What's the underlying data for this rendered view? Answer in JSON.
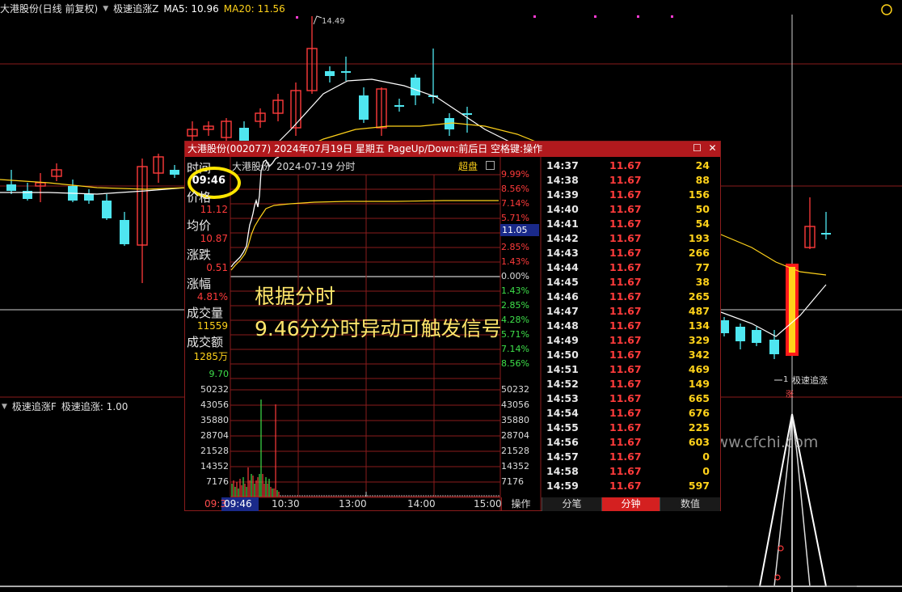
{
  "main_chart": {
    "stock_title": "大港股份(日线 前复权)",
    "indicator_name": "极速追涨Z",
    "ma5_label": "MA5: 10.96",
    "ma20_label": "MA20: 11.56",
    "peak_price_label": "14.49",
    "signal_label": "极速追涨",
    "signal_tag": "涨",
    "low_mark_label": "1"
  },
  "sub_chart": {
    "indicator_name": "极速追涨F",
    "value_label": "极速追涨: 1.00",
    "watermark": "www.cfchi.com"
  },
  "popup": {
    "title": "大港股份(002077) 2024年07月19日 星期五 PageUp/Down:前后日 空格键:操作",
    "header_name": "大港股份",
    "header_date": "2024-07-19 分时",
    "header_mode": "超盘",
    "left_panel": {
      "time_label": "时间",
      "time_value": "09:46",
      "price_label": "价格",
      "price_value": "11.12",
      "avg_label": "均价",
      "avg_value": "10.87",
      "change_label": "涨跌",
      "change_value": "0.51",
      "pct_label": "涨幅",
      "pct_value": "4.81%",
      "vol_label": "成交量",
      "vol_value": "11559",
      "amount_label": "成交额",
      "amount_value": "1285万"
    },
    "price_axis_left": [
      "9.70"
    ],
    "pct_axis": [
      "9.99%",
      "8.56%",
      "7.14%",
      "5.71%",
      "4.28%",
      "2.85%",
      "1.43%",
      "0.00%",
      "1.43%",
      "2.85%",
      "4.28%",
      "5.71%",
      "7.14%",
      "8.56%"
    ],
    "current_price_tag": "11.05",
    "volume_axis_left": [
      "50232",
      "43056",
      "35880",
      "28704",
      "21528",
      "14352",
      "7176"
    ],
    "volume_axis_right": [
      "50232",
      "43056",
      "35880",
      "28704",
      "21528",
      "14352",
      "7176"
    ],
    "x_ticks": [
      "09:3",
      "09:46",
      "10:30",
      "13:00",
      "14:00",
      "15:00"
    ],
    "operate_button": "操作",
    "annotation_line1": "根据分时",
    "annotation_line2": "9.46分分时异动可触发信号",
    "ticks": [
      {
        "time": "14:37",
        "price": "11.67",
        "vol": "24"
      },
      {
        "time": "14:38",
        "price": "11.67",
        "vol": "88"
      },
      {
        "time": "14:39",
        "price": "11.67",
        "vol": "156"
      },
      {
        "time": "14:40",
        "price": "11.67",
        "vol": "50"
      },
      {
        "time": "14:41",
        "price": "11.67",
        "vol": "54"
      },
      {
        "time": "14:42",
        "price": "11.67",
        "vol": "193"
      },
      {
        "time": "14:43",
        "price": "11.67",
        "vol": "266"
      },
      {
        "time": "14:44",
        "price": "11.67",
        "vol": "77"
      },
      {
        "time": "14:45",
        "price": "11.67",
        "vol": "38"
      },
      {
        "time": "14:46",
        "price": "11.67",
        "vol": "265"
      },
      {
        "time": "14:47",
        "price": "11.67",
        "vol": "487"
      },
      {
        "time": "14:48",
        "price": "11.67",
        "vol": "134"
      },
      {
        "time": "14:49",
        "price": "11.67",
        "vol": "329"
      },
      {
        "time": "14:50",
        "price": "11.67",
        "vol": "342"
      },
      {
        "time": "14:51",
        "price": "11.67",
        "vol": "469"
      },
      {
        "time": "14:52",
        "price": "11.67",
        "vol": "149"
      },
      {
        "time": "14:53",
        "price": "11.67",
        "vol": "665"
      },
      {
        "time": "14:54",
        "price": "11.67",
        "vol": "676"
      },
      {
        "time": "14:55",
        "price": "11.67",
        "vol": "225"
      },
      {
        "time": "14:56",
        "price": "11.67",
        "vol": "603"
      },
      {
        "time": "14:57",
        "price": "11.67",
        "vol": "0"
      },
      {
        "time": "14:58",
        "price": "11.67",
        "vol": "0"
      },
      {
        "time": "14:59",
        "price": "11.67",
        "vol": "597"
      }
    ],
    "tabs": [
      "分笔",
      "分钟",
      "数值"
    ],
    "active_tab": "分钟"
  },
  "colors": {
    "up": "#ff3b3b",
    "down": "#4fe6f0",
    "ma5": "#ffffff",
    "ma20": "#ffd21a",
    "grid": "#8a1c1c",
    "window_title": "#b1191d"
  }
}
